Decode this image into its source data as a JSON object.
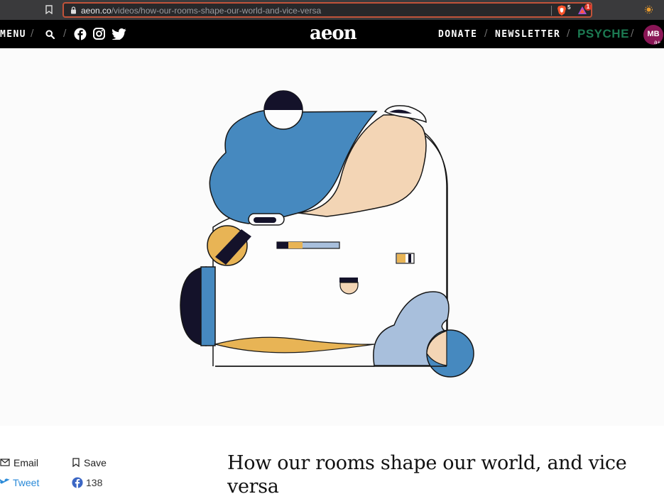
{
  "browser": {
    "url_domain": "aeon.co",
    "url_path": "/videos/how-our-rooms-shape-our-world-and-vice-versa",
    "shields_count": "5",
    "rewards_count": "1"
  },
  "header": {
    "menu_label": "MENU",
    "logo": "aeon",
    "donate_label": "DONATE",
    "newsletter_label": "NEWSLETTER",
    "psyche_label": "PSYCHE",
    "avatar_initials": "MB",
    "avatar_badge": "a+",
    "separator": "/"
  },
  "share": {
    "email_label": "Email",
    "save_label": "Save",
    "tweet_label": "Tweet",
    "facebook_count": "138"
  },
  "article": {
    "title": "How our rooms shape our world, and vice versa"
  },
  "icons": [
    "bookmark-icon",
    "lock-icon",
    "brave-shields-icon",
    "brave-rewards-icon",
    "extension-icon",
    "search-icon",
    "facebook-icon",
    "instagram-icon",
    "twitter-icon",
    "mail-icon",
    "bookmark-save-icon"
  ],
  "colors": {
    "header_bg": "#000000",
    "psyche_green": "#1c7a52",
    "avatar_bg": "#8a1656",
    "twitter_blue": "#2a8ad8",
    "url_focus": "#c1533a",
    "illus_blue": "#4689bf",
    "illus_peach": "#f3d5b5",
    "illus_yellow": "#e8b455",
    "illus_navy": "#14122a",
    "illus_lightblue": "#a8bfdc"
  }
}
